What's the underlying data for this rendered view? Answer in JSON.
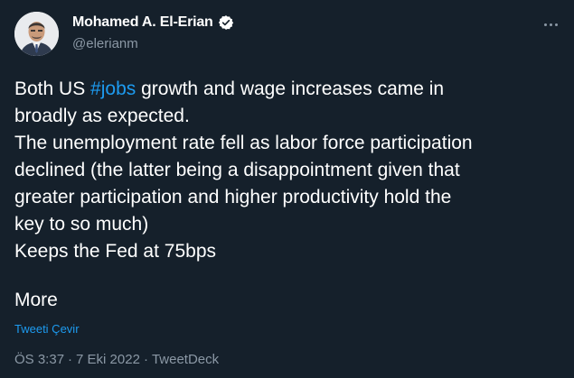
{
  "author": {
    "display_name": "Mohamed A. El-Erian",
    "handle": "@elerianm",
    "verified_icon": "verified-badge-icon"
  },
  "tweet": {
    "lines": [
      {
        "pre": "Both US ",
        "hashtag": "#jobs",
        "post": " growth and wage increases came in"
      },
      {
        "text": "broadly as expected."
      },
      {
        "text": "The unemployment rate fell as labor force participation"
      },
      {
        "text": "declined (the latter being a disappointment given that"
      },
      {
        "text": "greater participation and higher productivity hold the"
      },
      {
        "text": "key to so much)"
      },
      {
        "text": "Keeps the Fed at 75bps"
      }
    ],
    "more_label": "More",
    "translate_label": "Tweeti Çevir",
    "time": "ÖS 3:37",
    "date": "7 Eki 2022",
    "source": "TweetDeck",
    "separator": "·"
  },
  "colors": {
    "background": "#15202b",
    "text": "#ffffff",
    "secondary": "#8b98a5",
    "accent": "#1d9bf0"
  }
}
